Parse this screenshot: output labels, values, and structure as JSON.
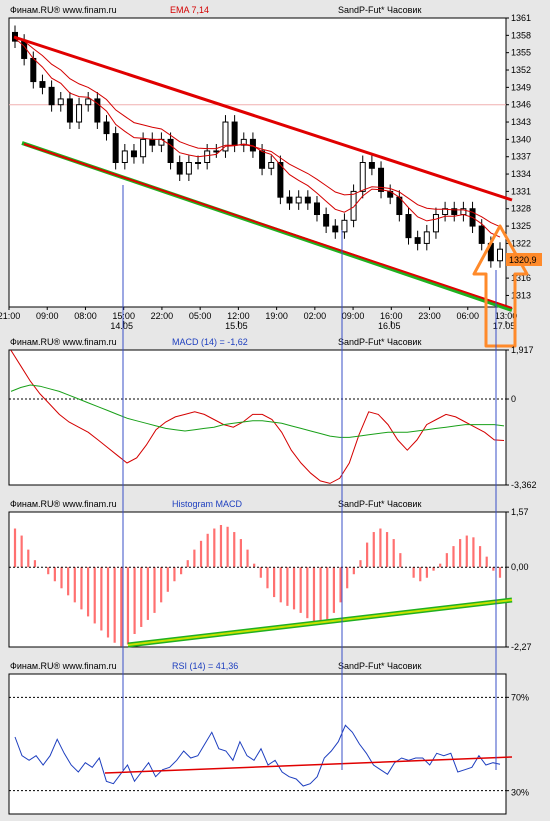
{
  "colors": {
    "background": "#e7e7e7",
    "pane_fill": "#ffffff",
    "candle_bull": "#ffffff",
    "candle_bear": "#000000",
    "ema_fast": "#d40000",
    "ema_slow": "#d40000",
    "macd_line": "#d40000",
    "signal_line": "#19a019",
    "histogram": "#ff7070",
    "rsi_line": "#1e3fbf",
    "trend_red": "#e00000",
    "trend_green": "#20b020",
    "trend_yellow": "#c8e000",
    "arrow": "#ff8a2a",
    "vline": "#3a4fc7",
    "price_label_bg": "#ff8a2a"
  },
  "panes": {
    "price": {
      "source": "Финам.RU® www.finam.ru",
      "indicator": "EMA 7,14",
      "instrument": "SandP-Fut* Часовик",
      "current_price": "1320,9"
    },
    "macd": {
      "source": "Финам.RU® www.finam.ru",
      "indicator": "MACD (14) = -1,62",
      "instrument": "SandP-Fut* Часовик"
    },
    "histogram": {
      "source": "Финам.RU® www.finam.ru",
      "indicator": "Histogram MACD",
      "instrument": "SandP-Fut* Часовик"
    },
    "rsi": {
      "source": "Финам.RU® www.finam.ru",
      "indicator": "RSI (14) = 41,36",
      "instrument": "SandP-Fut* Часовик"
    }
  },
  "chart_data": [
    {
      "type": "candlestick",
      "ylim": [
        1311,
        1361
      ],
      "y_ticks": [
        "1361",
        "1358",
        "1355",
        "1352",
        "1349",
        "1346",
        "1343",
        "1340",
        "1337",
        "1334",
        "1331",
        "1328",
        "1325",
        "1322",
        "1319",
        "1316",
        "1313"
      ],
      "x_ticks": [
        "21:00",
        "09:00",
        "08:00",
        "15:00",
        "22:00",
        "05:00",
        "12:00",
        "19:00",
        "02:00",
        "09:00",
        "16:00",
        "23:00",
        "06:00",
        "13:00"
      ],
      "x_dates": [
        "14.05",
        "15.05",
        "16.05",
        "17.05"
      ],
      "close": [
        1357,
        1354,
        1350,
        1349,
        1346,
        1347,
        1343,
        1346,
        1347,
        1343,
        1341,
        1336,
        1338,
        1337,
        1340,
        1339,
        1340,
        1336,
        1334,
        1336,
        1336,
        1338,
        1338,
        1343,
        1339,
        1340,
        1338,
        1335,
        1336,
        1330,
        1329,
        1330,
        1329,
        1327,
        1325,
        1324,
        1326,
        1331,
        1336,
        1335,
        1331,
        1330,
        1327,
        1323,
        1322,
        1324,
        1327,
        1328,
        1327,
        1328,
        1325,
        1322,
        1319,
        1321
      ],
      "series": [
        {
          "name": "EMA 7",
          "values": [
            1357.5,
            1356.1,
            1354.0,
            1352.5,
            1350.6,
            1349.7,
            1348.0,
            1347.4,
            1347.3,
            1346.2,
            1344.9,
            1342.6,
            1341.4,
            1340.3,
            1340.2,
            1340.0,
            1340.0,
            1339.0,
            1337.7,
            1337.3,
            1337.0,
            1337.2,
            1337.4,
            1338.8,
            1338.9,
            1339.2,
            1338.9,
            1337.9,
            1337.4,
            1335.6,
            1333.9,
            1332.9,
            1332.0,
            1330.7,
            1329.3,
            1327.9,
            1327.4,
            1328.3,
            1330.2,
            1331.4,
            1331.3,
            1331.0,
            1330.0,
            1328.2,
            1326.6,
            1325.9,
            1326.2,
            1326.7,
            1326.7,
            1327.0,
            1326.5,
            1325.4,
            1323.8,
            1323.1
          ]
        },
        {
          "name": "EMA 14",
          "values": [
            1357.8,
            1357.0,
            1355.7,
            1354.5,
            1353.0,
            1352.0,
            1350.5,
            1349.6,
            1349.0,
            1348.0,
            1346.9,
            1345.1,
            1344.0,
            1342.9,
            1342.5,
            1342.1,
            1341.8,
            1340.7,
            1339.6,
            1339.0,
            1338.5,
            1338.4,
            1338.4,
            1339.0,
            1339.0,
            1339.1,
            1338.8,
            1338.3,
            1337.9,
            1336.8,
            1335.7,
            1334.9,
            1334.1,
            1333.1,
            1332.0,
            1330.9,
            1330.4,
            1330.5,
            1331.2,
            1331.8,
            1331.7,
            1331.5,
            1330.9,
            1329.8,
            1328.7,
            1328.1,
            1327.9,
            1327.9,
            1327.8,
            1327.8,
            1327.4,
            1326.6,
            1325.6,
            1324.9
          ]
        },
        {
          "name": "trend-upper",
          "values": [
            1358,
            1331
          ]
        },
        {
          "name": "trend-lower",
          "values": [
            1340,
            1313
          ]
        }
      ]
    },
    {
      "type": "line",
      "ylim": [
        -3.362,
        1.917
      ],
      "y_ticks": [
        "1,917",
        "0",
        "-3,362"
      ],
      "series": [
        {
          "name": "MACD",
          "values": [
            1.9,
            1.3,
            0.7,
            0.2,
            -0.2,
            -0.6,
            -0.9,
            -1.1,
            -1.3,
            -1.6,
            -1.9,
            -2.2,
            -2.5,
            -2.3,
            -1.8,
            -1.2,
            -0.9,
            -0.7,
            -0.6,
            -0.5,
            -0.6,
            -0.8,
            -1.0,
            -1.1,
            -0.9,
            -0.6,
            -0.6,
            -0.8,
            -1.3,
            -2.0,
            -2.5,
            -2.9,
            -3.2,
            -3.3,
            -3.1,
            -2.5,
            -1.4,
            -0.5,
            -0.6,
            -1.0,
            -1.6,
            -2.0,
            -1.6,
            -1.0,
            -0.8,
            -0.6,
            -0.7,
            -0.9,
            -1.1,
            -1.3,
            -1.6,
            -1.62
          ]
        },
        {
          "name": "Signal",
          "values": [
            0.3,
            0.45,
            0.55,
            0.5,
            0.4,
            0.3,
            0.15,
            0.0,
            -0.15,
            -0.3,
            -0.45,
            -0.6,
            -0.75,
            -0.85,
            -0.95,
            -1.05,
            -1.15,
            -1.2,
            -1.25,
            -1.2,
            -1.15,
            -1.1,
            -1.0,
            -0.95,
            -0.9,
            -0.85,
            -0.85,
            -0.9,
            -0.95,
            -1.05,
            -1.15,
            -1.25,
            -1.35,
            -1.45,
            -1.5,
            -1.5,
            -1.45,
            -1.4,
            -1.35,
            -1.3,
            -1.3,
            -1.3,
            -1.25,
            -1.2,
            -1.15,
            -1.1,
            -1.05,
            -1.0,
            -1.0,
            -1.0,
            -1.0,
            -1.05
          ]
        }
      ]
    },
    {
      "type": "bar",
      "ylim": [
        -2.27,
        1.57
      ],
      "y_ticks": [
        "1,57",
        "0,00",
        "-2,27"
      ],
      "values": [
        1.1,
        0.9,
        0.5,
        0.2,
        0.0,
        -0.2,
        -0.4,
        -0.6,
        -0.8,
        -1.0,
        -1.2,
        -1.4,
        -1.6,
        -1.8,
        -2.0,
        -2.15,
        -2.25,
        -2.2,
        -1.9,
        -1.7,
        -1.5,
        -1.3,
        -1.0,
        -0.7,
        -0.4,
        -0.2,
        0.2,
        0.5,
        0.75,
        0.95,
        1.1,
        1.2,
        1.15,
        1.0,
        0.8,
        0.5,
        0.1,
        -0.3,
        -0.6,
        -0.85,
        -1.0,
        -1.1,
        -1.2,
        -1.3,
        -1.45,
        -1.55,
        -1.6,
        -1.5,
        -1.3,
        -1.0,
        -0.6,
        -0.2,
        0.2,
        0.7,
        1.0,
        1.1,
        1.0,
        0.8,
        0.4,
        0.0,
        -0.3,
        -0.4,
        -0.3,
        -0.1,
        0.1,
        0.4,
        0.6,
        0.8,
        0.9,
        0.85,
        0.6,
        0.3,
        -0.1,
        -0.3
      ]
    },
    {
      "type": "line",
      "ylim": [
        20,
        80
      ],
      "y_ticks": [
        "70%",
        "30%"
      ],
      "series": [
        {
          "name": "RSI",
          "values": [
            53,
            45,
            43,
            45,
            41,
            45,
            52,
            46,
            41,
            38,
            42,
            40,
            44,
            34,
            33,
            37,
            41,
            34,
            38,
            42,
            36,
            39,
            40,
            43,
            47,
            44,
            45,
            50,
            55,
            48,
            47,
            43,
            51,
            45,
            43,
            48,
            41,
            43,
            38,
            36,
            35,
            32,
            33,
            36,
            44,
            47,
            51,
            58,
            55,
            50,
            46,
            41,
            39,
            37,
            42,
            44,
            43,
            44,
            44,
            41,
            46,
            45,
            46,
            38,
            39,
            40,
            45,
            41,
            42,
            41.36
          ]
        }
      ]
    }
  ]
}
